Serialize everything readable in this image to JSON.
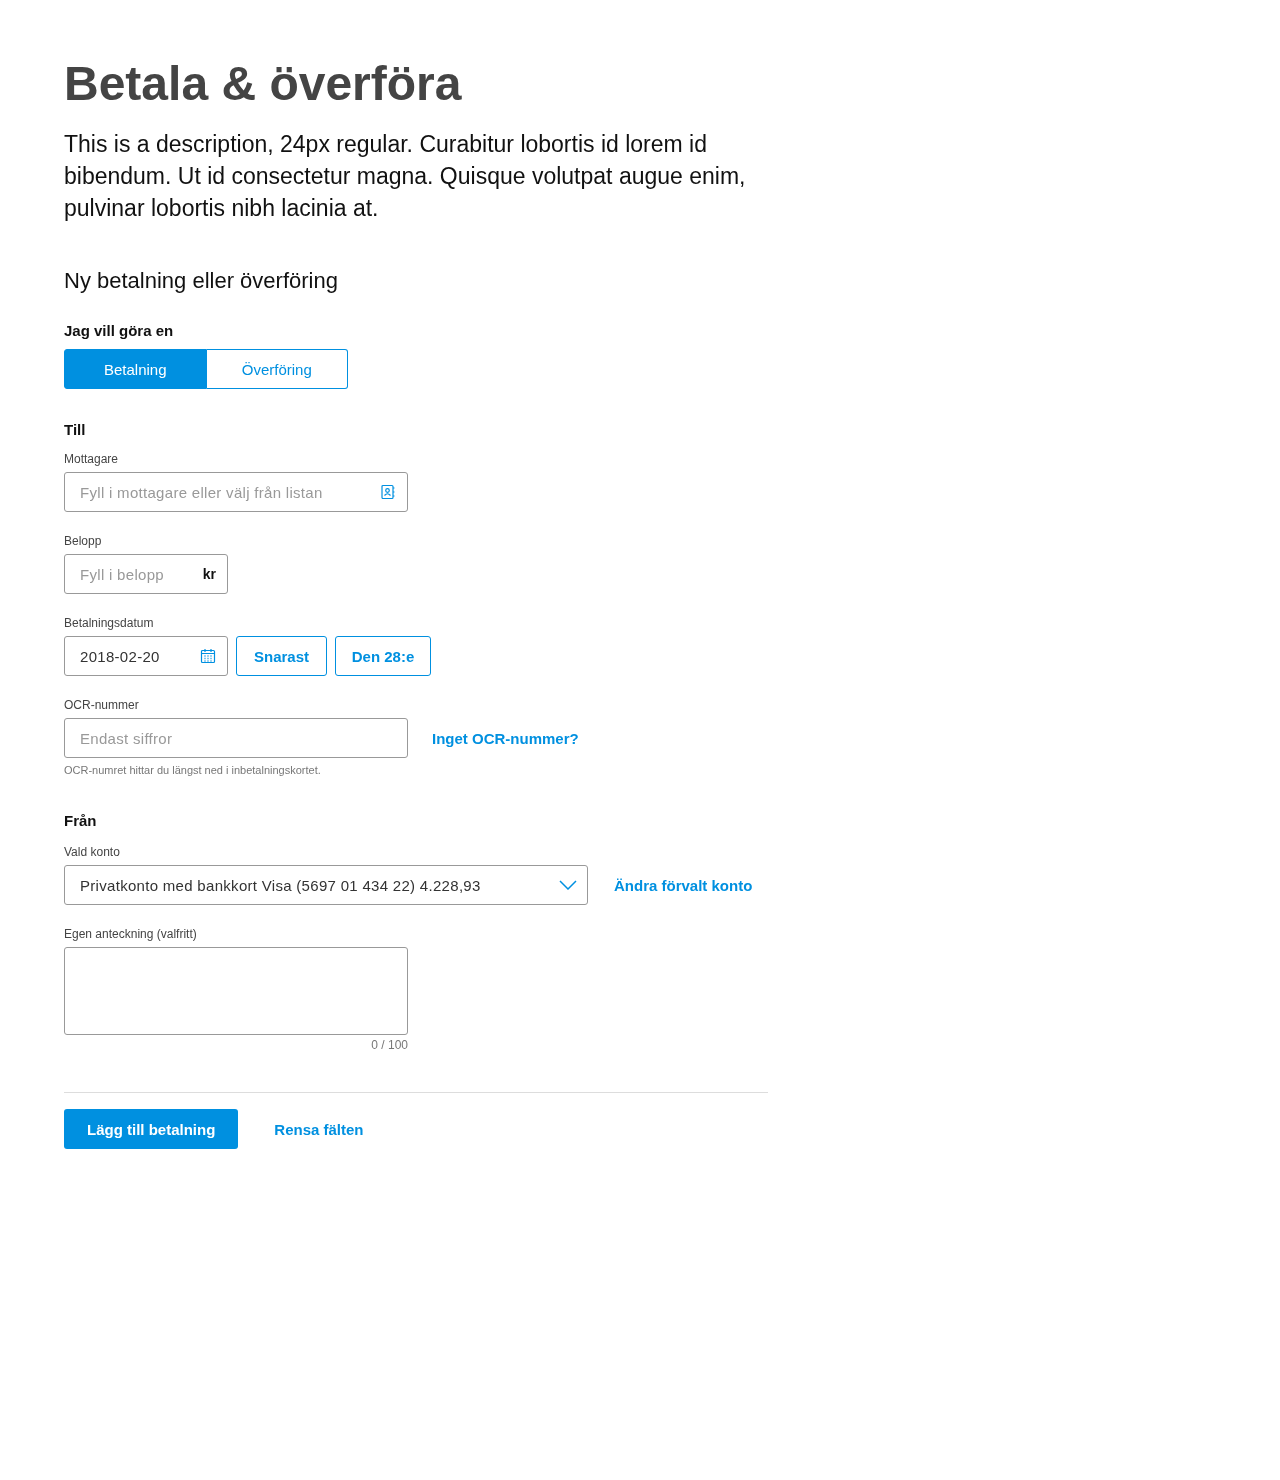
{
  "title": "Betala & överföra",
  "description": "This is a description, 24px regular. Curabitur lobortis id lorem id bibendum. Ut id consectetur magna. Quisque volutpat augue enim, pulvinar lobortis nibh lacinia at.",
  "form_title": "Ny betalning eller överföring",
  "type_choice": {
    "label": "Jag vill göra en",
    "options": [
      {
        "label": "Betalning",
        "selected": true
      },
      {
        "label": "Överföring",
        "selected": false
      }
    ]
  },
  "to_section": {
    "heading": "Till",
    "recipient": {
      "label": "Mottagare",
      "placeholder": "Fyll i mottagare eller välj från listan"
    },
    "amount": {
      "label": "Belopp",
      "placeholder": "Fyll i belopp",
      "unit": "kr"
    },
    "date": {
      "label": "Betalningsdatum",
      "value": "2018-02-20",
      "buttons": [
        "Snarast",
        "Den 28:e"
      ]
    },
    "ocr": {
      "label": "OCR-nummer",
      "placeholder": "Endast siffror",
      "link": "Inget OCR-nummer?",
      "hint": "OCR-numret hittar du längst ned i inbetalningskortet."
    }
  },
  "from_section": {
    "heading": "Från",
    "account": {
      "label": "Vald konto",
      "value": "Privatkonto med bankkort Visa (5697 01 434 22) 4.228,93",
      "link": "Ändra förvalt konto"
    },
    "note": {
      "label": "Egen anteckning (valfritt)",
      "counter": "0 / 100"
    }
  },
  "actions": {
    "primary": "Lägg till betalning",
    "secondary": "Rensa fälten"
  }
}
